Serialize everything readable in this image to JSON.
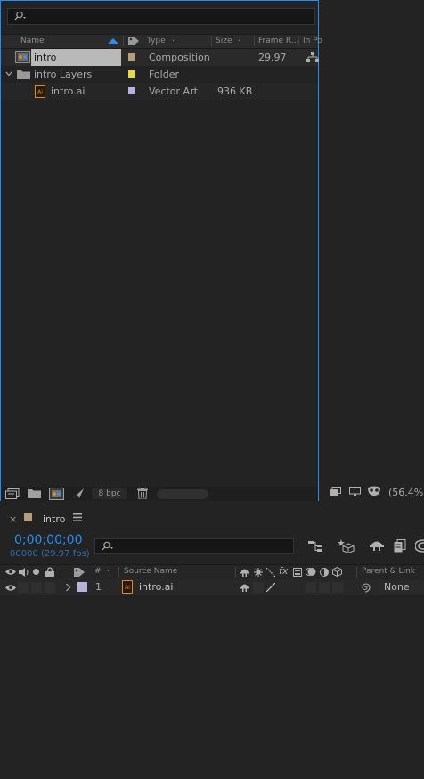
{
  "project": {
    "columns": {
      "name": "Name",
      "type": "Type",
      "size": "Size",
      "frame_rate": "Frame R...",
      "in_point": "In Po"
    },
    "items": [
      {
        "name": "intro",
        "type": "Composition",
        "size": "",
        "frame_rate": "29.97",
        "label_color": "#b39f7c"
      },
      {
        "name": "intro Layers",
        "type": "Folder",
        "size": "",
        "frame_rate": "",
        "label_color": "#e5d94a"
      },
      {
        "name": "intro.ai",
        "type": "Vector Art",
        "size": "936 KB",
        "frame_rate": "",
        "label_color": "#b8b2d8"
      }
    ],
    "bpc": "8 bpc"
  },
  "viewer": {
    "zoom": "(56.4%)"
  },
  "timeline": {
    "tab_label": "intro",
    "timecode": "0;00;00;00",
    "fps_readout": "00000 (29.97 fps)",
    "columns": {
      "hash": "#",
      "source_name": "Source Name",
      "parent_link": "Parent & Link"
    },
    "layers": [
      {
        "index": "1",
        "name": "intro.ai",
        "parent": "None",
        "label_color": "#b8b2d8"
      }
    ]
  }
}
